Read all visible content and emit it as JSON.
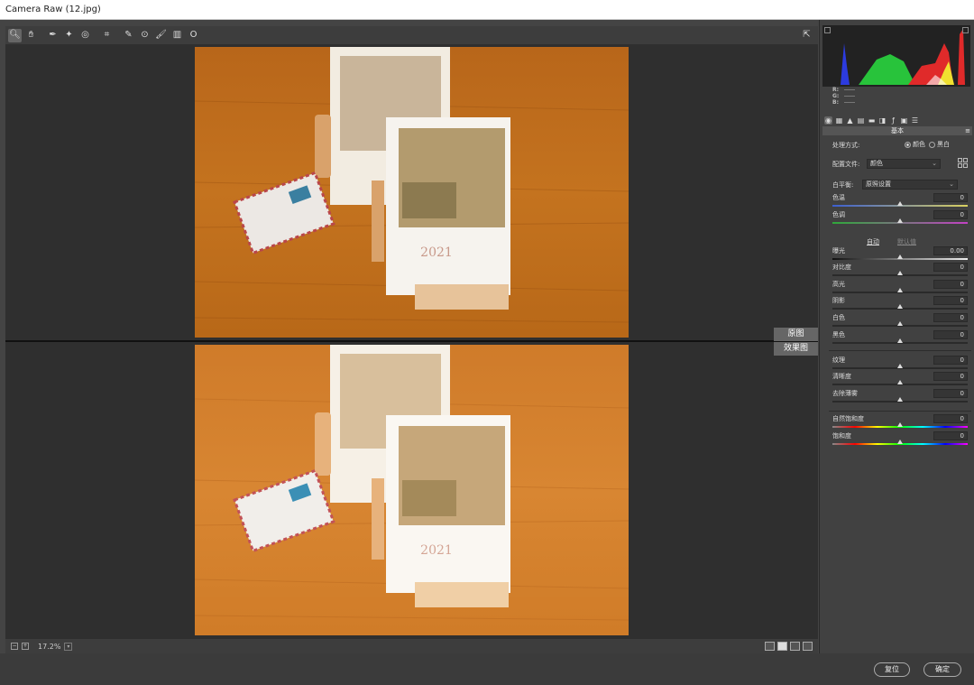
{
  "window": {
    "title": "Camera Raw (12.jpg)"
  },
  "toolbar": {
    "tools": [
      {
        "name": "zoom-tool",
        "glyph": "🔍︎"
      },
      {
        "name": "hand-tool",
        "glyph": "✋︎"
      },
      {
        "name": "white-balance-tool",
        "glyph": "✒"
      },
      {
        "name": "color-sampler-tool",
        "glyph": "✦"
      },
      {
        "name": "target-adjustment-tool",
        "glyph": "◎"
      },
      {
        "name": "crop-tool",
        "glyph": "⌗"
      },
      {
        "name": "spot-removal-tool",
        "glyph": "✎"
      },
      {
        "name": "red-eye-tool",
        "glyph": "⊙"
      },
      {
        "name": "adjustment-brush-tool",
        "glyph": "🖌︎"
      },
      {
        "name": "graduated-filter-tool",
        "glyph": "▥"
      },
      {
        "name": "radial-filter-tool",
        "glyph": "O"
      }
    ]
  },
  "preview": {
    "before_label": "原图",
    "after_label": "效果图"
  },
  "status": {
    "zoom": "17.2%"
  },
  "histogram": {
    "r_label": "R:",
    "g_label": "G:",
    "b_label": "B:"
  },
  "panel": {
    "section_title": "基本",
    "treatment_label": "处理方式:",
    "treatment_color": "颜色",
    "treatment_bw": "黑白",
    "profile_label": "配置文件:",
    "profile_value": "颜色",
    "wb_label": "白平衡:",
    "wb_value": "原照设置",
    "auto_label": "自动",
    "defaults_label": "默认值",
    "sliders": [
      {
        "key": "temp",
        "label": "色温",
        "value": "0",
        "pos": 0.5,
        "track": "temp"
      },
      {
        "key": "tint",
        "label": "色调",
        "value": "0",
        "pos": 0.5,
        "track": "tint"
      },
      {
        "key": "exposure",
        "label": "曝光",
        "value": "0.00",
        "pos": 0.5,
        "track": "expo"
      },
      {
        "key": "contrast",
        "label": "对比度",
        "value": "0",
        "pos": 0.5,
        "track": "plain"
      },
      {
        "key": "highlights",
        "label": "高光",
        "value": "0",
        "pos": 0.5,
        "track": "plain"
      },
      {
        "key": "shadows",
        "label": "阴影",
        "value": "0",
        "pos": 0.5,
        "track": "plain"
      },
      {
        "key": "whites",
        "label": "白色",
        "value": "0",
        "pos": 0.5,
        "track": "plain"
      },
      {
        "key": "blacks",
        "label": "黑色",
        "value": "0",
        "pos": 0.5,
        "track": "plain"
      },
      {
        "key": "texture",
        "label": "纹理",
        "value": "0",
        "pos": 0.5,
        "track": "plain"
      },
      {
        "key": "clarity",
        "label": "清晰度",
        "value": "0",
        "pos": 0.5,
        "track": "plain"
      },
      {
        "key": "dehaze",
        "label": "去除薄雾",
        "value": "0",
        "pos": 0.5,
        "track": "plain"
      },
      {
        "key": "vibrance",
        "label": "自然饱和度",
        "value": "0",
        "pos": 0.5,
        "track": "sat"
      },
      {
        "key": "saturation",
        "label": "饱和度",
        "value": "0",
        "pos": 0.5,
        "track": "sat"
      }
    ]
  },
  "footer": {
    "reset_label": "复位",
    "ok_label": "确定"
  },
  "colors": {
    "panel_bg": "#414141",
    "canvas_bg": "#2f2f2f",
    "wood": "#c8751f"
  }
}
